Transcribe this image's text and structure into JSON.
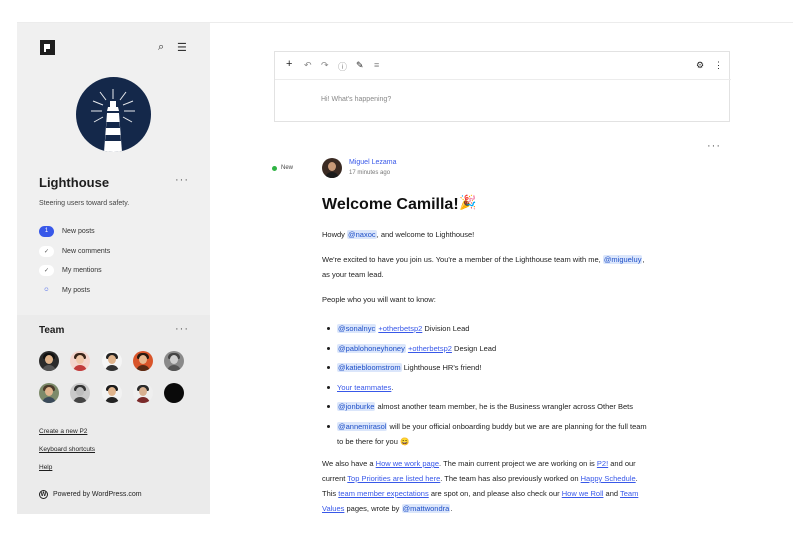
{
  "sidebar": {
    "site_title": "Lighthouse",
    "more_glyph": "···",
    "description": "Steering users toward safety.",
    "search_glyph": "⌕",
    "menu_glyph": "☰",
    "nav": [
      {
        "label": "New posts",
        "badge": "1"
      },
      {
        "label": "New comments",
        "badge": "✓"
      },
      {
        "label": "My mentions",
        "badge": "✓"
      },
      {
        "label": "My posts",
        "badge": "☺"
      }
    ],
    "team_title": "Team",
    "links": [
      "Create a new P2",
      "Keyboard shortcuts",
      "Help"
    ],
    "powered_by": "Powered by WordPress.com",
    "wp_glyph": "W"
  },
  "colors": {
    "accent": "#3858e9",
    "sidebar_bg": "#f0f0f0",
    "mention_bg": "#dbe6fb",
    "avatar_bg": "#14284a",
    "new_dot": "#2fb344"
  },
  "editor": {
    "toolbar_icons": [
      {
        "name": "add-block-icon",
        "glyph": "+"
      },
      {
        "name": "undo-icon",
        "glyph": "↶"
      },
      {
        "name": "redo-icon",
        "glyph": "↷"
      },
      {
        "name": "info-icon",
        "glyph": "ⓘ"
      },
      {
        "name": "edit-pen-icon",
        "glyph": "✎"
      },
      {
        "name": "list-view-icon",
        "glyph": "≡"
      }
    ],
    "settings_glyph": "⚙",
    "options_glyph": "⋮",
    "placeholder": "Hi! What's happening?"
  },
  "post": {
    "new_label": "New",
    "more_glyph": "···",
    "author": "Miguel Lezama",
    "time": "17 minutes ago",
    "title": "Welcome Camilla!",
    "title_emoji": "🎉",
    "p1_pre": "Howdy ",
    "p1_mention": "@naxoc",
    "p1_post": ", and welcome to Lighthouse!",
    "p2_pre": "We're excited to have you join us. You're a member of the Lighthouse team with me, ",
    "p2_mention": "@migueluy",
    "p2_post": ",",
    "p2_line2": "as your team lead.",
    "p3": "People who you will want to know:",
    "bullets": {
      "b1_mention": "@sonalnyc",
      "b1_link": "+otherbetsp2",
      "b1_text": " Division Lead",
      "b2_mention": "@pablohoneyhoney",
      "b2_link": "+otherbetsp2",
      "b2_text": " Design Lead",
      "b3_mention": "@katiebloomstrom",
      "b3_text": " Lighthouse HR's friend!",
      "b4_link": "Your teammates",
      "b4_text": ".",
      "b5_mention": "@jonburke",
      "b5_text": " almost another team member, he is the Business wrangler across Other Bets",
      "b6_mention": "@annemirasol",
      "b6_text": " will be your official onboarding buddy but we are are planning for the full team",
      "b6_line2": "to be there for you 😄"
    },
    "p4": {
      "t1": "We also have a ",
      "l1": "How we work page",
      "t2": ". The main current project we are working on is ",
      "l2": "P2!",
      "t3": " and our",
      "t4": "current ",
      "l3": "Top Priorities are listed here",
      "t5": ". The team has also previously worked on ",
      "l4": "Happy Schedule",
      "t6": ".",
      "t7": "This ",
      "l5": "team member expectations",
      "t8": " are spot on, and please also check our ",
      "l6": "How we Roll",
      "t9": " and ",
      "l7": "Team",
      "l8": "Values",
      "t10": " pages, wrote by ",
      "m1": "@mattwondra",
      "t11": "."
    }
  }
}
